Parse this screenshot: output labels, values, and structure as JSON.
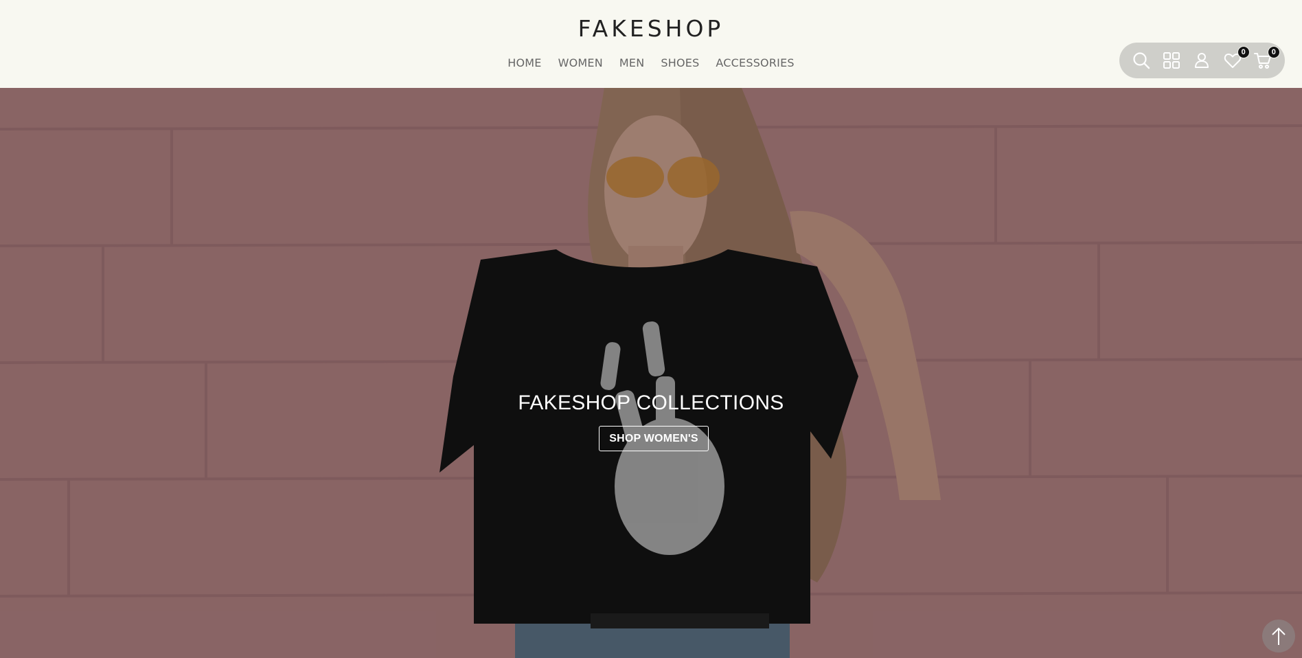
{
  "header": {
    "brand": "FAKESHOP",
    "nav": [
      {
        "label": "HOME"
      },
      {
        "label": "WOMEN"
      },
      {
        "label": "MEN"
      },
      {
        "label": "SHOES"
      },
      {
        "label": "ACCESSORIES"
      }
    ],
    "toolbar": {
      "icons": [
        "search-icon",
        "grid-icon",
        "user-icon",
        "heart-icon",
        "cart-icon"
      ],
      "wishlist_count": "0",
      "cart_count": "0"
    }
  },
  "hero": {
    "title": "FAKESHOP COLLECTIONS",
    "button_label": "SHOP WOMEN'S"
  },
  "colors": {
    "header_bg": "#f8f8f1",
    "toolbar_bg": "#cfcfca",
    "hero_wall": "#b98788",
    "text_dark": "#222222"
  }
}
